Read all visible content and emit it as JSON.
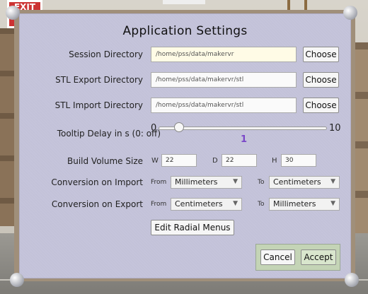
{
  "window": {
    "title": "Application Settings"
  },
  "rows": {
    "session": {
      "label": "Session Directory",
      "value": "/home/pss/data/makervr",
      "button": "Choose"
    },
    "stl_export": {
      "label": "STL Export Directory",
      "value": "/home/pss/data/makervr/stl",
      "button": "Choose"
    },
    "stl_import": {
      "label": "STL Import Directory",
      "value": "/home/pss/data/makervr/stl",
      "button": "Choose"
    }
  },
  "tooltip": {
    "label": "Tooltip Delay in s (0: off)",
    "min": "0",
    "max": "10",
    "value": "1",
    "fraction": 0.1
  },
  "build_volume": {
    "label": "Build Volume Size",
    "w_label": "W",
    "w": "22",
    "d_label": "D",
    "d": "22",
    "h_label": "H",
    "h": "30"
  },
  "conversion_import": {
    "label": "Conversion on Import",
    "from_label": "From",
    "from": "Millimeters",
    "to_label": "To",
    "to": "Centimeters"
  },
  "conversion_export": {
    "label": "Conversion on Export",
    "from_label": "From",
    "from": "Centimeters",
    "to_label": "To",
    "to": "Millimeters"
  },
  "edit_radial": "Edit Radial Menus",
  "footer": {
    "cancel": "Cancel",
    "accept": "Accept"
  },
  "scene_sign": "EXIT",
  "colors": {
    "panel": "#c3c2d9",
    "accent_value": "#7a47c8",
    "footer": "#c4d4b6"
  },
  "icons": {
    "select_chevron": "chevron-down-icon"
  }
}
